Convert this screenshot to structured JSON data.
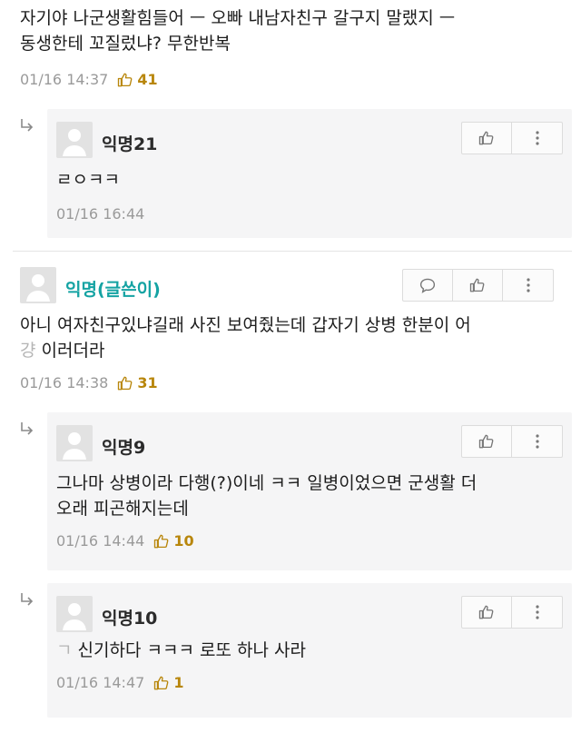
{
  "post": {
    "text_line1": "자기야 나군생활힘들어 ㅡ 오빠 내남자친구 갈구지 말랬지 ㅡ",
    "text_line2": "동생한테 꼬질렀냐? 무한반복",
    "time": "01/16 14:37",
    "likes": "41"
  },
  "reply1": {
    "name": "익명21",
    "text": "ㄹㅇㅋㅋ",
    "time": "01/16 16:44"
  },
  "comment2": {
    "name": "익명(글쓴이)",
    "text_line1": "아니 여자친구있냐길래 사진 보여줬는데 갑자기 상병 한분이 어",
    "text_line2": "이러더라",
    "text_line2_prefix": "걍",
    "time": "01/16 14:38",
    "likes": "31"
  },
  "reply2": {
    "name": "익명9",
    "text_line1": "그나마 상병이라 다행(?)이네 ㅋㅋ 일병이었으면 군생활 더",
    "text_line2": "오래 피곤해지는데",
    "time": "01/16 14:44",
    "likes": "10"
  },
  "reply3": {
    "name": "익명10",
    "text_prefix": "ㄱ",
    "text": "신기하다 ㅋㅋㅋ 로또 하나 사라",
    "time": "01/16 14:47",
    "likes": "1"
  },
  "icons": {
    "like": "thumbs-up-icon",
    "more": "more-vertical-icon",
    "comment": "comment-icon",
    "reply": "reply-arrow-icon",
    "avatar": "default-avatar-icon"
  },
  "colors": {
    "like_count": "#b8860b",
    "op_name": "#15a3a3",
    "reply_bg": "#f5f5f6"
  }
}
